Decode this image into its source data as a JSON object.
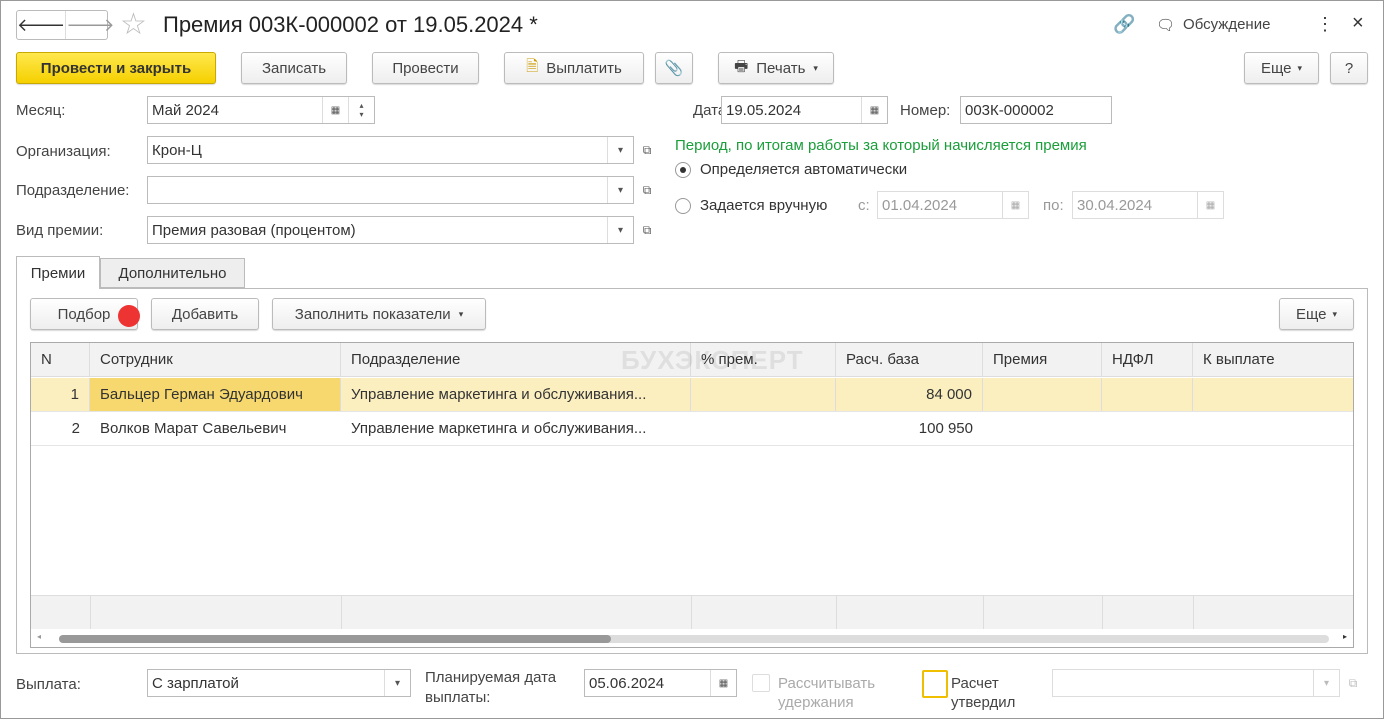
{
  "window": {
    "title": "Премия 003К-000002 от 19.05.2024 *",
    "discussion": "Обсуждение",
    "close": "×",
    "more": "⋮"
  },
  "toolbar": {
    "post_close": "Провести и закрыть",
    "save": "Записать",
    "post": "Провести",
    "pay": "Выплатить",
    "print": "Печать",
    "more": "Еще",
    "help": "?"
  },
  "form": {
    "month_label": "Месяц:",
    "month": "Май 2024",
    "date_label": "Дата:",
    "date": "19.05.2024",
    "number_label": "Номер:",
    "number": "003К-000002",
    "org_label": "Организация:",
    "org": "Крон-Ц",
    "dept_label": "Подразделение:",
    "dept": "",
    "type_label": "Вид премии:",
    "type": "Премия разовая (процентом)",
    "period_title": "Период, по итогам работы за который начисляется премия",
    "auto": "Определяется автоматически",
    "manual": "Задается вручную",
    "from_label": "с:",
    "from": "01.04.2024",
    "to_label": "по:",
    "to": "30.04.2024"
  },
  "tabs": [
    {
      "label": "Премии"
    },
    {
      "label": "Дополнительно"
    }
  ],
  "table_toolbar": {
    "pick": "Подбор",
    "add": "Добавить",
    "fill": "Заполнить показатели",
    "more": "Еще"
  },
  "watermark": "БУХЭКСПЕРТ",
  "table": {
    "columns": [
      "N",
      "Сотрудник",
      "Подразделение",
      "% прем.",
      "Расч. база",
      "Премия",
      "НДФЛ",
      "К выплате"
    ],
    "rows": [
      [
        "1",
        "Бальцер Герман Эдуардович",
        "Управление маркетинга и обслуживания...",
        "",
        "84 000",
        "",
        "",
        ""
      ],
      [
        "2",
        "Волков Марат Савельевич",
        "Управление маркетинга и обслуживания...",
        "",
        "100 950",
        "",
        "",
        ""
      ]
    ]
  },
  "footer": {
    "pay_label": "Выплата:",
    "pay": "С зарплатой",
    "planned_label": "Планируемая дата выплаты:",
    "planned": "05.06.2024",
    "calc_ded": "Рассчитывать удержания",
    "approved": "Расчет утвердил",
    "approver": ""
  }
}
